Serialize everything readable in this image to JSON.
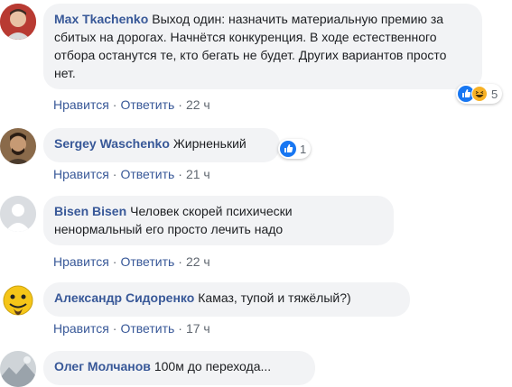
{
  "comments": [
    {
      "author": "Max Tkachenko",
      "text": "Выход один: назначить материальную премию за сбитых на дорогах. Начнётся конкуренция. В ходе естественного отбора останутся те, кто бегать не будет. Других вариантов просто нет.",
      "like_label": "Нравится",
      "reply_label": "Ответить",
      "time": "22 ч",
      "reaction_count": "5",
      "reaction_icons": [
        "like-icon",
        "haha-icon"
      ]
    },
    {
      "author": "Sergey Waschenko",
      "text": "Жирненький",
      "like_label": "Нравится",
      "reply_label": "Ответить",
      "time": "21 ч",
      "reaction_count": "1",
      "reaction_icons": [
        "like-icon"
      ]
    },
    {
      "author": "Bisen Bisen",
      "text": "Человек скорей психически ненормальный его просто лечить надо",
      "like_label": "Нравится",
      "reply_label": "Ответить",
      "time": "22 ч"
    },
    {
      "author": "Александр Сидоренко",
      "text": "Камаз, тупой и тяжёлый?)",
      "like_label": "Нравится",
      "reply_label": "Ответить",
      "time": "17 ч"
    },
    {
      "author": "Олег Молчанов",
      "text": "100м до перехода..."
    }
  ],
  "colors": {
    "link": "#385898",
    "bubble": "#f2f3f5",
    "meta": "#606770",
    "like_blue": "#1877f2",
    "haha_yellow": "#f7b125"
  }
}
